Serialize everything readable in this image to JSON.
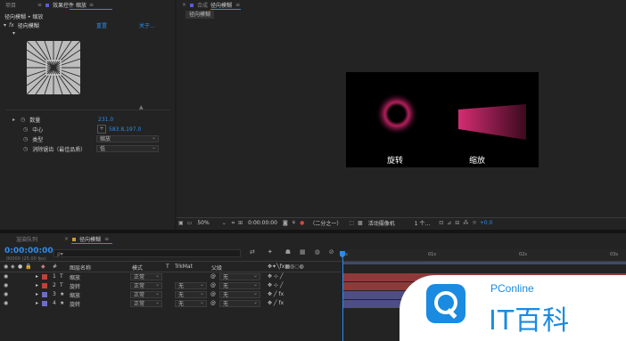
{
  "project_tab": "项目",
  "effect_controls_tab": "效果控件 缩放",
  "composition_tab_prefix": "合成",
  "composition_tab_name": "径向模糊",
  "breadcrumb": "径向模糊 • 缩放",
  "effect_name": "径向模糊",
  "reset_label": "重置",
  "about_label": "关于...",
  "props": {
    "amount_label": "数量",
    "amount_value": "231.0",
    "center_label": "中心",
    "center_value": "583.8,197.0",
    "type_label": "类型",
    "type_value": "缩放",
    "aa_label": "消除锯齿（最佳品质）",
    "aa_value": "低"
  },
  "preview_labels": {
    "rotate": "旋转",
    "zoom": "缩放"
  },
  "viewer_toolbar": {
    "zoom": "50%",
    "timecode": "0:00:00:00",
    "resolution": "（二分之一）",
    "camera": "活动摄像机",
    "views": "1 个...",
    "exposure": "+0.0"
  },
  "render_queue_tab": "渲染队列",
  "timeline_tab": "径向模糊",
  "timecode": "0:00:00:00",
  "timecode_sub": "00000 (25.00 fps)",
  "search_placeholder": "ρ▾",
  "columns": {
    "num": "#",
    "name": "图层名称",
    "mode": "模式",
    "t": "T",
    "trkmat": "TrkMat",
    "parent": "父级"
  },
  "ruler": [
    "0s",
    "01s",
    "02s",
    "03s"
  ],
  "layers": [
    {
      "num": "1",
      "type": "T",
      "name": "缩放",
      "mode": "正常",
      "trkmat": "",
      "parent": "无",
      "color": "#c0413b"
    },
    {
      "num": "2",
      "type": "T",
      "name": "旋转",
      "mode": "正常",
      "trkmat": "无",
      "parent": "无",
      "color": "#c0413b"
    },
    {
      "num": "3",
      "type": "★",
      "name": "缩放",
      "mode": "正常",
      "trkmat": "无",
      "parent": "无",
      "color": "#6d6dc6"
    },
    {
      "num": "4",
      "type": "★",
      "name": "旋转",
      "mode": "正常",
      "trkmat": "无",
      "parent": "无",
      "color": "#6d6dc6"
    }
  ],
  "watermark": {
    "brand": "PConline",
    "title": "IT百科"
  }
}
